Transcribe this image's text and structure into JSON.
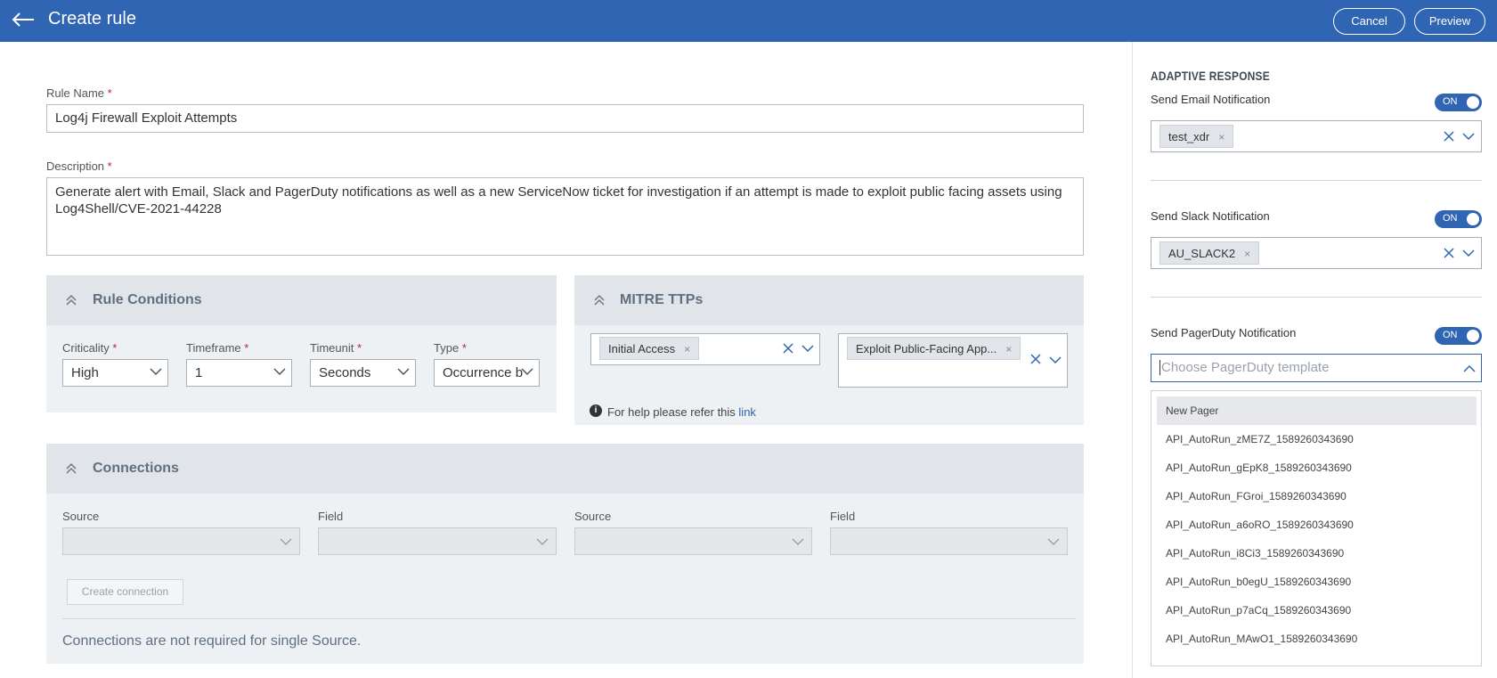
{
  "header": {
    "title": "Create rule",
    "cancel_label": "Cancel",
    "preview_label": "Preview"
  },
  "form": {
    "rule_name_label": "Rule Name",
    "rule_name_value": "Log4j Firewall Exploit Attempts",
    "description_label": "Description",
    "description_value": "Generate alert with Email, Slack and PagerDuty notifications as well as a new ServiceNow ticket for investigation if an attempt is made to exploit public facing assets using Log4Shell/CVE-2021-44228",
    "required_mark": "*"
  },
  "conditions": {
    "title": "Rule Conditions",
    "criticality_label": "Criticality",
    "criticality_value": "High",
    "timeframe_label": "Timeframe",
    "timeframe_value": "1",
    "timeunit_label": "Timeunit",
    "timeunit_value": "Seconds",
    "type_label": "Type",
    "type_value": "Occurrence b"
  },
  "mitre": {
    "title": "MITRE TTPs",
    "tactic_chip": "Initial Access",
    "technique_chip": "Exploit Public-Facing App...",
    "chip_remove": "×",
    "help_text": "For help please refer this",
    "help_link": "link"
  },
  "connections": {
    "title": "Connections",
    "source1_label": "Source",
    "field1_label": "Field",
    "source2_label": "Source",
    "field2_label": "Field",
    "create_button": "Create connection",
    "note": "Connections are not required for single Source."
  },
  "adaptive": {
    "title": "ADAPTIVE RESPONSE",
    "toggle_on": "ON",
    "email_label": "Send Email Notification",
    "email_chip": "test_xdr",
    "slack_label": "Send Slack Notification",
    "slack_chip": "AU_SLACK2",
    "pager_label": "Send PagerDuty Notification",
    "pager_placeholder": "Choose PagerDuty template",
    "pager_options": [
      "New Pager",
      "API_AutoRun_zME7Z_1589260343690",
      "API_AutoRun_gEpK8_1589260343690",
      "API_AutoRun_FGroi_1589260343690",
      "API_AutoRun_a6oRO_1589260343690",
      "API_AutoRun_i8Ci3_1589260343690",
      "API_AutoRun_b0egU_1589260343690",
      "API_AutoRun_p7aCq_1589260343690",
      "API_AutoRun_MAwO1_1589260343690"
    ]
  },
  "colors": {
    "header_bg": "#2f65b3",
    "required": "#c8202f",
    "panel_bg": "#eef1f4"
  }
}
